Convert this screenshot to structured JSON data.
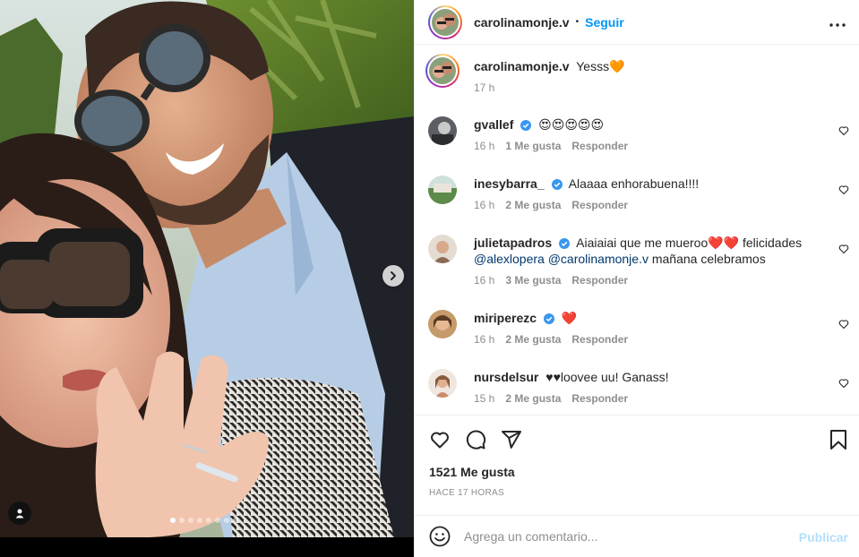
{
  "post": {
    "username": "carolinamonje.v",
    "follow_label": "Seguir",
    "bullet": "•"
  },
  "caption": {
    "username": "carolinamonje.v",
    "text": "Yesss🧡",
    "time": "17 h"
  },
  "comments": [
    {
      "username": "gvallef",
      "verified": true,
      "text": "😍😍😍😍😍",
      "time": "16 h",
      "likes": "1 Me gusta",
      "reply": "Responder"
    },
    {
      "username": "inesybarra_",
      "verified": true,
      "text": "Alaaaa enhorabuena!!!!",
      "time": "16 h",
      "likes": "2 Me gusta",
      "reply": "Responder"
    },
    {
      "username": "julietapadros",
      "verified": true,
      "text": "Aiaiaiai que me mueroo❤️❤️ felicidades",
      "mention1": "@alexlopera",
      "mention2": "@carolinamonje.v",
      "text2": "mañana celebramos",
      "time": "16 h",
      "likes": "3 Me gusta",
      "reply": "Responder"
    },
    {
      "username": "miriperezc",
      "verified": true,
      "text": "❤️",
      "time": "16 h",
      "likes": "2 Me gusta",
      "reply": "Responder"
    },
    {
      "username": "nursdelsur",
      "verified": false,
      "text": "♥♥loovee uu! Ganass!",
      "time": "15 h",
      "likes": "2 Me gusta",
      "reply": "Responder"
    }
  ],
  "actions": {
    "likes": "1521 Me gusta",
    "ago": "HACE 17 HORAS"
  },
  "composer": {
    "placeholder": "Agrega un comentario...",
    "publish_label": "Publicar"
  },
  "carousel": {
    "total": 8,
    "active": 1
  },
  "icons": {
    "more": "more-horizontal-icon",
    "like": "heart-icon",
    "comment": "comment-icon",
    "share": "paper-plane-icon",
    "save": "bookmark-icon",
    "emoji": "emoji-icon",
    "next": "chevron-right-icon",
    "tags": "user-tag-icon"
  },
  "colors": {
    "accent": "#0095f6",
    "publish_disabled": "#b2dffc",
    "heart_emoji": "#ed4956",
    "verified": "#3897f0",
    "secondary_text": "#8e8e8e"
  }
}
